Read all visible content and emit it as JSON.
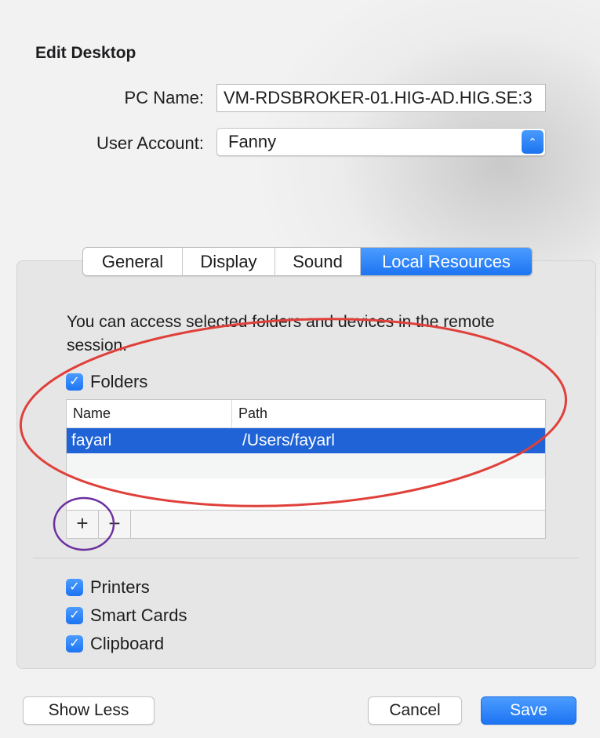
{
  "dialog": {
    "title": "Edit Desktop"
  },
  "form": {
    "pc_name_label": "PC Name:",
    "pc_name_value": "VM-RDSBROKER-01.HIG-AD.HIG.SE:3",
    "user_account_label": "User Account:",
    "user_account_value": "Fanny"
  },
  "tabs": [
    {
      "label": "General",
      "selected": false
    },
    {
      "label": "Display",
      "selected": false
    },
    {
      "label": "Sound",
      "selected": false
    },
    {
      "label": "Local Resources",
      "selected": true
    }
  ],
  "local_resources": {
    "description": "You can access selected folders and devices in the remote session.",
    "folders": {
      "label": "Folders",
      "checked": true,
      "columns": [
        "Name",
        "Path"
      ],
      "rows": [
        {
          "name": "fayarl",
          "path": "/Users/fayarl",
          "selected": true
        }
      ],
      "add_label": "+",
      "remove_label": "−"
    },
    "devices": [
      {
        "label": "Printers",
        "checked": true
      },
      {
        "label": "Smart Cards",
        "checked": true
      },
      {
        "label": "Clipboard",
        "checked": true
      }
    ]
  },
  "footer": {
    "show_less": "Show Less",
    "cancel": "Cancel",
    "save": "Save"
  },
  "icons": {
    "checkbox": "checkmark-icon",
    "stepper": "up-down-chevron-icon"
  },
  "colors": {
    "accent": "#1d74f2",
    "selection": "#1f63d6",
    "annotation_red": "#e0403a",
    "annotation_purple": "#6b2fa0"
  }
}
